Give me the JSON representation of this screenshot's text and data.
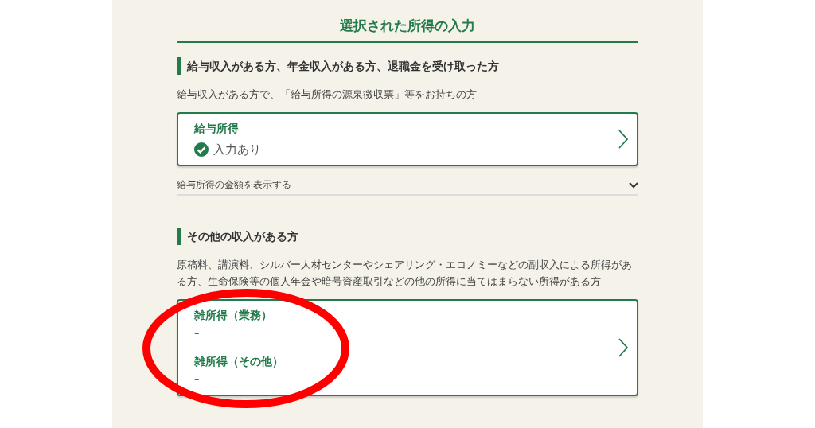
{
  "page_title": "選択された所得の入力",
  "sections": [
    {
      "heading": "給与収入がある方、年金収入がある方、退職金を受け取った方",
      "description": "給与収入がある方で、「給与所得の源泉徴収票」等をお持ちの方",
      "card": {
        "items": [
          {
            "label": "給与所得",
            "status": "入力あり",
            "entered": true
          }
        ]
      },
      "toggle": {
        "label": "給与所得の金額を表示する",
        "expanded": false
      }
    },
    {
      "heading": "その他の収入がある方",
      "description": "原稿料、講演料、シルバー人材センターやシェアリング・エコノミーなどの副収入による所得がある方、生命保険等の個人年金や暗号資産取引などの他の所得に当てはまらない所得がある方",
      "card": {
        "items": [
          {
            "label": "雑所得（業務）",
            "status": "–",
            "entered": false
          },
          {
            "label": "雑所得（その他）",
            "status": "–",
            "entered": false
          }
        ]
      }
    }
  ],
  "annotation": {
    "kind": "ellipse"
  }
}
